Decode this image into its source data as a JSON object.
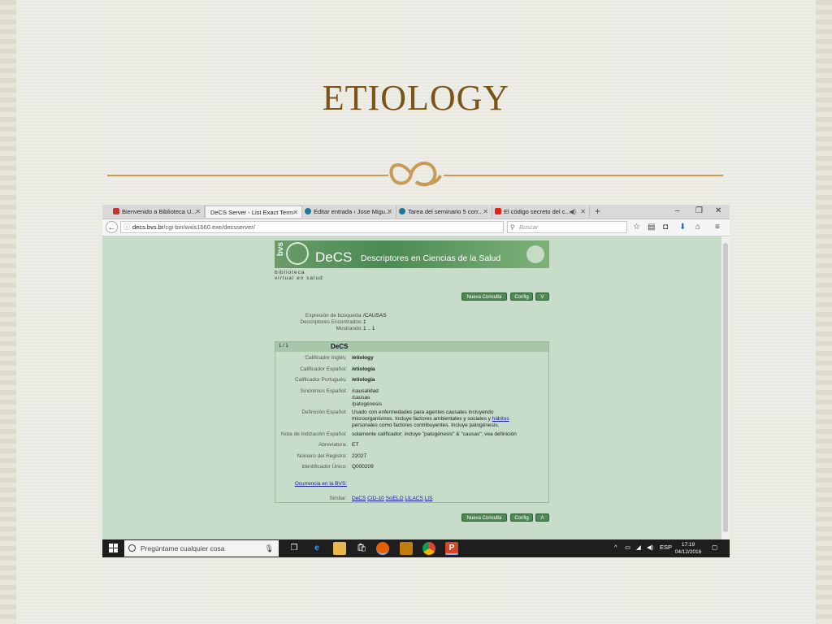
{
  "slide": {
    "title": "ETIOLOGY",
    "accent_color": "#7b5418",
    "rule_color": "#c79a55",
    "ornament_icon": "floral-ornament"
  },
  "browser": {
    "tabs": [
      {
        "label": "Bienvenido a Biblioteca U...",
        "icon": "library-favicon",
        "active": false
      },
      {
        "label": "DeCS Server - List Exact Term",
        "icon": "none",
        "active": true
      },
      {
        "label": "Editar entrada ‹ Jose Migu...",
        "icon": "wordpress-favicon",
        "active": false
      },
      {
        "label": "Tarea del seminario 5 corr...",
        "icon": "wordpress-favicon",
        "active": false
      },
      {
        "label": "El código secreto del c...",
        "icon": "youtube-favicon",
        "active": false
      }
    ],
    "new_tab": "+",
    "window_controls": [
      "–",
      "❐",
      "✕"
    ],
    "url_domain": "decs.bvs.br",
    "url_path": "/cgi-bin/wxis1660.exe/decsserver/",
    "search_placeholder": "Buscar",
    "toolbar_icons": [
      "star-icon",
      "clipboard-icon",
      "pocket-icon",
      "download-icon",
      "home-icon",
      "menu-icon"
    ]
  },
  "decs": {
    "banner_logo": "bvs",
    "banner_brand": "DeCS",
    "banner_title": "Descriptores en Ciencias de la Salud",
    "biblio_line1": "biblioteca",
    "biblio_line2": "virtual en salud",
    "top_buttons": {
      "nueva": "Nueva Consulta",
      "config": "Config",
      "v": "V"
    },
    "bottom_buttons": {
      "nueva": "Nueva Consulta",
      "config": "Config",
      "up": "Λ"
    },
    "search_info": {
      "expr_label": "Expresión de búsqueda:",
      "expr_value": "/CAUSAS",
      "found_label": "Descriptores Encontrados:",
      "found_value": "1",
      "showing_label": "Mostrando:",
      "showing_value": "1 .. 1"
    },
    "record": {
      "page": "1 / 1",
      "heading": "DeCS",
      "calif_en_label": "Calificador Inglés:",
      "calif_en": "/etiology",
      "calif_es_label": "Calificador Español:",
      "calif_es": "/etiología",
      "calif_pt_label": "Calificador Portugués:",
      "calif_pt": "/etiologia",
      "syn_label": "Sinónimos Español:",
      "syn": [
        "/causalidad",
        "/causas",
        "/patogénesis"
      ],
      "def_label": "Definición Español:",
      "def_line1": "Usado con enfermedades para agentes causales incluyendo",
      "def_line2a": "microorganismos. Incluye factores ambientales y sociales y",
      "def_link": "hábitos",
      "def_line3": "personales como factores contribuyentes. Incluye patogénesis.",
      "note_label": "Nota de Indización Español:",
      "note": "solamente calificador; incluye \"patogénesis\" & \"causas\"; vea definición",
      "abbr_label": "Abreviatura:",
      "abbr": "ET",
      "reg_label": "Número del Registro:",
      "reg": "22027",
      "uid_label": "Identificador Único:",
      "uid": "Q000209",
      "occurrence_link": "Ocurrencia en la BVS:",
      "similar_label": "Similar:",
      "similar": [
        "DeCS",
        "CID-10",
        "SciELO",
        "LILACS",
        "LIS"
      ]
    }
  },
  "taskbar": {
    "search_placeholder": "Pregúntame cualquier cosa",
    "apps": [
      "task-view-icon",
      "edge-icon",
      "file-explorer-icon",
      "store-icon",
      "firefox-icon",
      "photos-icon",
      "chrome-icon",
      "powerpoint-icon"
    ],
    "lang": "ESP",
    "time": "17:19",
    "date": "04/12/2016"
  }
}
